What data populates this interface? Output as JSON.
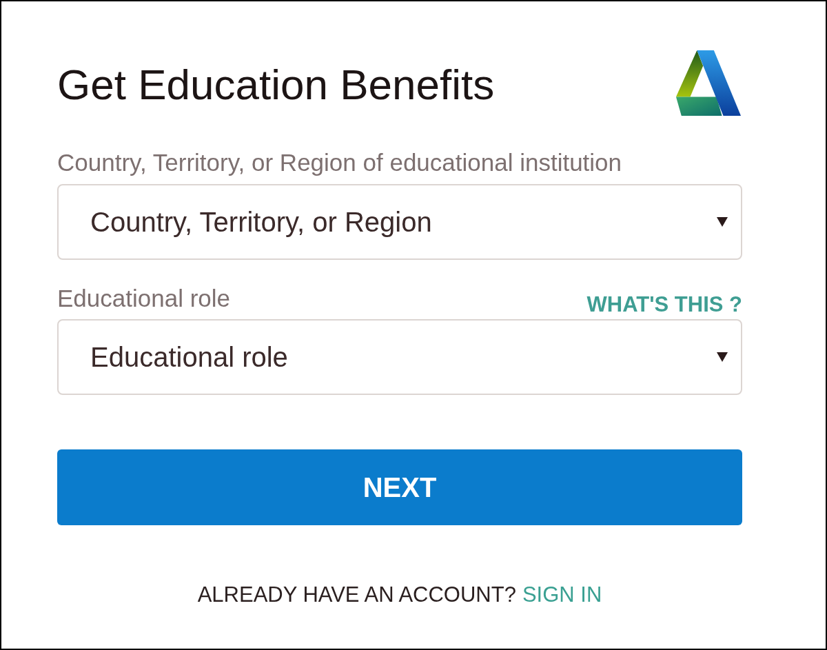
{
  "title": "Get Education Benefits",
  "fields": [
    {
      "label": "Country, Territory, or Region of educational institution",
      "placeholder": "Country, Territory, or Region"
    },
    {
      "label": "Educational role",
      "help_link": "WHAT'S THIS ?",
      "placeholder": "Educational role"
    }
  ],
  "next_button": "NEXT",
  "footer": {
    "text": "ALREADY HAVE AN ACCOUNT?",
    "link": "SIGN IN"
  }
}
